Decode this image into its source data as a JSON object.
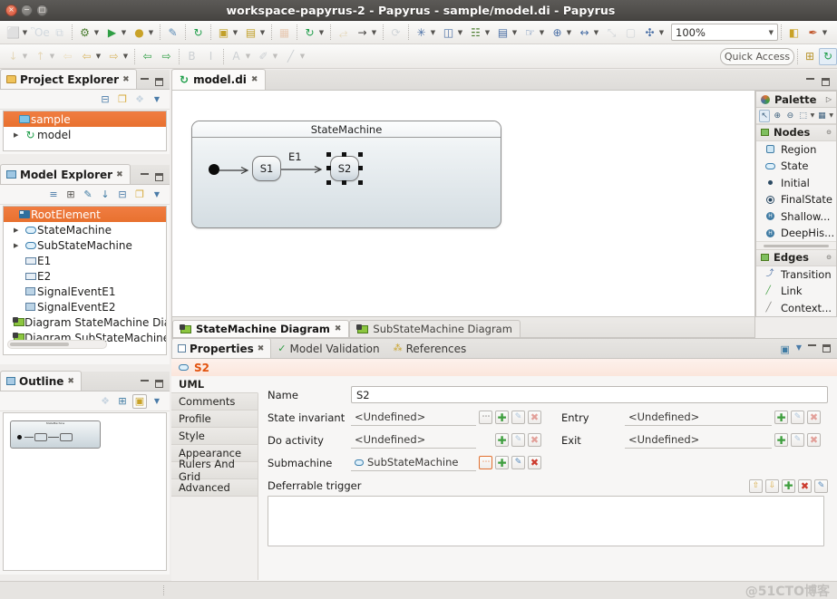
{
  "window": {
    "title": "workspace-papyrus-2 - Papyrus - sample/model.di - Papyrus",
    "close_icon": "close-icon",
    "minimize_icon": "minimize-icon",
    "maximize_icon": "maximize-icon"
  },
  "toolbar": {
    "zoom_value": "100%",
    "quick_access": "Quick Access",
    "row1": [
      {
        "name": "new-wizard",
        "glyph": "⬜",
        "color": "#d9a441",
        "menu": true,
        "enabled": true
      },
      {
        "name": "save",
        "glyph": "Ὃe",
        "color": "#8fa6bb",
        "menu": false,
        "enabled": false
      },
      {
        "name": "save-all",
        "glyph": "⧉",
        "color": "#8fa6bb",
        "menu": false,
        "enabled": false
      },
      {
        "name": "debug",
        "glyph": "⚙",
        "color": "#4a7c2f",
        "menu": true,
        "enabled": true
      },
      {
        "name": "run",
        "glyph": "▶",
        "color": "#2f9e44",
        "menu": true,
        "enabled": true
      },
      {
        "name": "run-configuration",
        "glyph": "●",
        "color": "#c9a227",
        "menu": true,
        "enabled": true
      },
      {
        "name": "external-tools",
        "glyph": "✎",
        "color": "#5a8ab5",
        "menu": false,
        "enabled": true
      },
      {
        "name": "papyrus-perspective",
        "glyph": "↻",
        "color": "#1f9e4a",
        "menu": false,
        "enabled": true
      },
      {
        "name": "new-model",
        "glyph": "▣",
        "color": "#c2a02a",
        "menu": true,
        "enabled": true
      },
      {
        "name": "new-diagram",
        "glyph": "▤",
        "color": "#c2a02a",
        "menu": true,
        "enabled": true
      },
      {
        "name": "new-table",
        "glyph": "▦",
        "color": "#d07a3a",
        "menu": false,
        "enabled": false
      },
      {
        "name": "papyrus-tools",
        "glyph": "↻",
        "color": "#1f9e4a",
        "menu": true,
        "enabled": true
      },
      {
        "name": "sync-model",
        "glyph": "⥄",
        "color": "#c8a24a",
        "menu": false,
        "enabled": false
      },
      {
        "name": "arrow-tool",
        "glyph": "→",
        "color": "#4a4845",
        "menu": true,
        "enabled": true
      },
      {
        "name": "refresh-diagram",
        "glyph": "⟳",
        "color": "#8a9aa8",
        "menu": false,
        "enabled": false
      },
      {
        "name": "arrange-all",
        "glyph": "✳",
        "color": "#4a6fa5",
        "menu": true,
        "enabled": true
      },
      {
        "name": "align-nodes",
        "glyph": "◫",
        "color": "#4a6fa5",
        "menu": true,
        "enabled": true
      },
      {
        "name": "distribute-nodes",
        "glyph": "☷",
        "color": "#4a7c2f",
        "menu": true,
        "enabled": true
      },
      {
        "name": "order-elements",
        "glyph": "▤",
        "color": "#4a6fa5",
        "menu": true,
        "enabled": true
      },
      {
        "name": "select-tool",
        "glyph": "☞",
        "color": "#4a6fa5",
        "menu": true,
        "enabled": true
      },
      {
        "name": "filter-tool",
        "glyph": "⊕",
        "color": "#4a6fa5",
        "menu": true,
        "enabled": true
      },
      {
        "name": "resize-tool",
        "glyph": "↔",
        "color": "#4a6fa5",
        "menu": true,
        "enabled": true
      },
      {
        "name": "snap-to-grid",
        "glyph": "⤡",
        "color": "#8a9aa8",
        "menu": false,
        "enabled": false
      },
      {
        "name": "show-grid",
        "glyph": "▢",
        "color": "#8a9aa8",
        "menu": false,
        "enabled": false
      },
      {
        "name": "zoom-fit",
        "glyph": "✣",
        "color": "#4a6fa5",
        "menu": true,
        "enabled": true
      }
    ],
    "row1_tail": [
      {
        "name": "open-perspective",
        "glyph": "◧",
        "color": "#c9a227",
        "menu": false,
        "enabled": true
      },
      {
        "name": "papyrus-wizard",
        "glyph": "✒",
        "color": "#c0562a",
        "menu": true,
        "enabled": true
      }
    ],
    "row2": [
      {
        "name": "previous-annotation",
        "glyph": "↓",
        "color": "#c8a24a",
        "menu": true,
        "enabled": false
      },
      {
        "name": "next-annotation",
        "glyph": "↑",
        "color": "#c8a24a",
        "menu": true,
        "enabled": false
      },
      {
        "name": "back-history",
        "glyph": "⇦",
        "color": "#d9b866",
        "menu": false,
        "enabled": false
      },
      {
        "name": "forward-history",
        "glyph": "⇦",
        "color": "#d9b866",
        "menu": true,
        "enabled": true
      },
      {
        "name": "last-edit-location",
        "glyph": "⇨",
        "color": "#d9b866",
        "menu": true,
        "enabled": true
      },
      {
        "name": "navigate-back",
        "glyph": "⇦",
        "color": "#2f9e44",
        "menu": false,
        "enabled": true
      },
      {
        "name": "navigate-forward",
        "glyph": "⇨",
        "color": "#2f9e44",
        "menu": false,
        "enabled": true
      },
      {
        "name": "bold",
        "glyph": "B",
        "color": "#7a8894",
        "menu": false,
        "enabled": false
      },
      {
        "name": "italic",
        "glyph": "I",
        "color": "#7a8894",
        "menu": false,
        "enabled": false
      },
      {
        "name": "font-color",
        "glyph": "A",
        "color": "#7a8894",
        "menu": true,
        "enabled": false
      },
      {
        "name": "fill-color",
        "glyph": "✐",
        "color": "#7a8894",
        "menu": true,
        "enabled": false
      },
      {
        "name": "line-style",
        "glyph": "╱",
        "color": "#7a8894",
        "menu": true,
        "enabled": false
      }
    ],
    "perspective_buttons": [
      {
        "name": "open-perspective-button",
        "glyph": "⊞"
      },
      {
        "name": "papyrus-perspective-button",
        "glyph": "↻"
      }
    ]
  },
  "project_explorer": {
    "tab_label": "Project Explorer",
    "toolbar_icons": [
      "collapse-all-icon",
      "link-with-editor-icon",
      "focus-icon",
      "view-menu-icon"
    ],
    "items": [
      {
        "label": "sample",
        "icon": "project-folder-icon",
        "selected": true,
        "expanded": true,
        "indent": 0
      },
      {
        "label": "model",
        "icon": "papyrus-model-icon",
        "selected": false,
        "expanded": false,
        "indent": 1
      }
    ]
  },
  "model_explorer": {
    "tab_label": "Model Explorer",
    "toolbar_icons": [
      "list-icon",
      "tree-icon",
      "edit-icon",
      "sort-icon",
      "collapse-all-icon",
      "link-with-editor-icon",
      "view-menu-icon"
    ],
    "items": [
      {
        "label": "RootElement",
        "icon": "root-element-icon",
        "selected": true,
        "twisty": "",
        "indent": 0
      },
      {
        "label": "StateMachine",
        "icon": "state-machine-icon",
        "selected": false,
        "twisty": "collapsed",
        "indent": 1
      },
      {
        "label": "SubStateMachine",
        "icon": "state-machine-icon",
        "selected": false,
        "twisty": "collapsed",
        "indent": 1
      },
      {
        "label": "E1",
        "icon": "event-icon",
        "selected": false,
        "twisty": "",
        "indent": 1
      },
      {
        "label": "E2",
        "icon": "event-icon",
        "selected": false,
        "twisty": "",
        "indent": 1
      },
      {
        "label": "SignalEventE1",
        "icon": "signal-event-icon",
        "selected": false,
        "twisty": "",
        "indent": 1
      },
      {
        "label": "SignalEventE2",
        "icon": "signal-event-icon",
        "selected": false,
        "twisty": "",
        "indent": 1
      },
      {
        "label": "Diagram StateMachine Diagr",
        "icon": "diagram-icon",
        "selected": false,
        "twisty": "",
        "indent": 1
      },
      {
        "label": "Diagram SubStateMachine D",
        "icon": "diagram-icon",
        "selected": false,
        "twisty": "",
        "indent": 1
      }
    ]
  },
  "outline": {
    "tab_label": "Outline",
    "toolbar_icons": [
      "focus-icon",
      "hierarchy-icon",
      "overview-icon",
      "view-menu-icon"
    ],
    "preview_title": "StateMachine"
  },
  "editor": {
    "tab_label": "model.di",
    "tab_icon": "papyrus-model-icon",
    "diagram_tabs": [
      {
        "label": "StateMachine Diagram",
        "active": true,
        "icon": "diagram-icon"
      },
      {
        "label": "SubStateMachine Diagram",
        "active": false,
        "icon": "diagram-icon"
      }
    ],
    "diagram": {
      "frame_title": "StateMachine",
      "initial_node": "initial-pseudostate",
      "states": [
        {
          "name": "S1",
          "selected": false
        },
        {
          "name": "S2",
          "selected": true
        }
      ],
      "transitions": [
        {
          "label": "E1",
          "from": "S1",
          "to": "S2"
        },
        {
          "label": "",
          "from": "initial",
          "to": "S1"
        }
      ]
    }
  },
  "palette": {
    "title": "Palette",
    "collapse_icon": "chevron-right-icon",
    "tools": [
      {
        "name": "select-tool",
        "glyph": "↖",
        "selected": true
      },
      {
        "name": "zoom-in-tool",
        "glyph": "⊕",
        "selected": false
      },
      {
        "name": "zoom-out-tool",
        "glyph": "⊖",
        "selected": false
      },
      {
        "name": "marquee-tool",
        "glyph": "⬚",
        "selected": false,
        "menu": true
      },
      {
        "name": "palette-settings-tool",
        "glyph": "▦",
        "selected": false,
        "menu": true
      }
    ],
    "groups": [
      {
        "name": "Nodes",
        "items": [
          {
            "label": "Region",
            "icon": "region-icon"
          },
          {
            "label": "State",
            "icon": "state-icon"
          },
          {
            "label": "Initial",
            "icon": "initial-icon"
          },
          {
            "label": "FinalState",
            "icon": "final-state-icon"
          },
          {
            "label": "Shallow...",
            "icon": "shallow-history-icon"
          },
          {
            "label": "DeepHis...",
            "icon": "deep-history-icon"
          }
        ]
      },
      {
        "name": "Edges",
        "items": [
          {
            "label": "Transition",
            "icon": "transition-icon"
          },
          {
            "label": "Link",
            "icon": "link-icon"
          },
          {
            "label": "Context...",
            "icon": "context-link-icon"
          }
        ]
      }
    ]
  },
  "properties": {
    "tabs": [
      {
        "label": "Properties",
        "active": true,
        "icon": "properties-icon"
      },
      {
        "label": "Model Validation",
        "active": false,
        "icon": "check-icon"
      },
      {
        "label": "References",
        "active": false,
        "icon": "references-icon"
      }
    ],
    "view_icons": [
      "pin-icon",
      "view-menu-icon",
      "minimize-icon",
      "maximize-icon"
    ],
    "selected_element": "S2",
    "selected_element_icon": "state-icon",
    "side_tabs": [
      {
        "label": "UML",
        "active": true
      },
      {
        "label": "Comments",
        "active": false
      },
      {
        "label": "Profile",
        "active": false
      },
      {
        "label": "Style",
        "active": false
      },
      {
        "label": "Appearance",
        "active": false
      },
      {
        "label": "Rulers And Grid",
        "active": false
      },
      {
        "label": "Advanced",
        "active": false
      }
    ],
    "fields": {
      "name_label": "Name",
      "name_value": "S2",
      "state_invariant_label": "State invariant",
      "state_invariant_value": "<Undefined>",
      "do_activity_label": "Do activity",
      "do_activity_value": "<Undefined>",
      "submachine_label": "Submachine",
      "submachine_value": "SubStateMachine",
      "submachine_icon": "state-machine-icon",
      "entry_label": "Entry",
      "entry_value": "<Undefined>",
      "exit_label": "Exit",
      "exit_value": "<Undefined>",
      "deferrable_trigger_label": "Deferrable trigger",
      "deferrable_trigger_value": ""
    },
    "row_buttons": {
      "browse": "⋯",
      "add": "✚",
      "edit": "✎",
      "delete": "✖",
      "up": "⇧",
      "down": "⇩"
    }
  },
  "statusbar": {
    "watermark": "@51CTO博客"
  }
}
